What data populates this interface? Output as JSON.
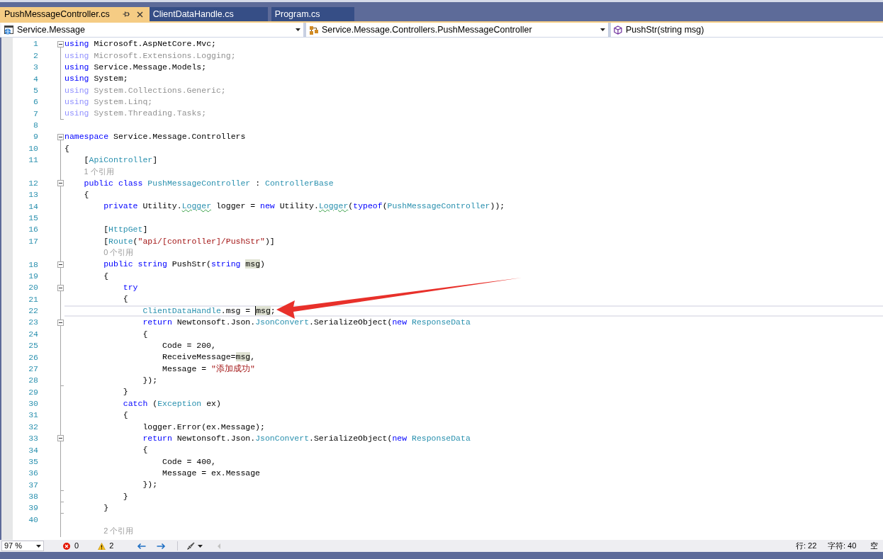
{
  "tabs": [
    {
      "label": "PushMessageController.cs",
      "selected": true
    },
    {
      "label": "ClientDataHandle.cs",
      "selected": false
    },
    {
      "label": "Program.cs",
      "selected": false
    }
  ],
  "navigation": [
    {
      "kind": "project",
      "text": "Service.Message"
    },
    {
      "kind": "class",
      "text": "Service.Message.Controllers.PushMessageController"
    },
    {
      "kind": "method",
      "text": "PushStr(string msg)"
    }
  ],
  "editor": {
    "lines": [
      {
        "kind": "code",
        "number": "1",
        "collapsible": true,
        "unused": false,
        "current": false,
        "tokens": [
          {
            "text": "using",
            "kind": "keyword"
          },
          {
            "text": " Microsoft.AspNetCore.Mvc;",
            "kind": "plain"
          }
        ]
      },
      {
        "kind": "code",
        "number": "2",
        "unused": true,
        "current": false,
        "tokens": [
          {
            "text": "using",
            "kind": "keyword"
          },
          {
            "text": " Microsoft.Extensions.Logging;",
            "kind": "plain"
          }
        ]
      },
      {
        "kind": "code",
        "number": "3",
        "unused": false,
        "current": false,
        "tokens": [
          {
            "text": "using",
            "kind": "keyword"
          },
          {
            "text": " Service.Message.Models;",
            "kind": "plain"
          }
        ]
      },
      {
        "kind": "code",
        "number": "4",
        "unused": false,
        "current": false,
        "tokens": [
          {
            "text": "using",
            "kind": "keyword"
          },
          {
            "text": " System;",
            "kind": "plain"
          }
        ]
      },
      {
        "kind": "code",
        "number": "5",
        "unused": true,
        "current": false,
        "tokens": [
          {
            "text": "using",
            "kind": "keyword"
          },
          {
            "text": " System.Collections.Generic;",
            "kind": "plain"
          }
        ]
      },
      {
        "kind": "code",
        "number": "6",
        "unused": true,
        "current": false,
        "tokens": [
          {
            "text": "using",
            "kind": "keyword"
          },
          {
            "text": " System.Linq;",
            "kind": "plain"
          }
        ]
      },
      {
        "kind": "code",
        "number": "7",
        "region_end": true,
        "unused": true,
        "current": false,
        "tokens": [
          {
            "text": "using",
            "kind": "keyword"
          },
          {
            "text": " System.Threading.Tasks;",
            "kind": "plain"
          }
        ]
      },
      {
        "kind": "code",
        "number": "8",
        "current": false
      },
      {
        "kind": "code",
        "number": "9",
        "collapsible": true,
        "unused": false,
        "current": false,
        "tokens": [
          {
            "text": "namespace",
            "kind": "keyword"
          },
          {
            "text": " Service.Message.Controllers",
            "kind": "plain"
          }
        ]
      },
      {
        "kind": "code",
        "number": "10",
        "unused": false,
        "current": false,
        "tokens": [
          {
            "text": "{",
            "kind": "plain"
          }
        ],
        "children": [
          {
            "kind": "code",
            "number": "11",
            "unused": false,
            "current": false,
            "tokens": [
              {
                "text": "[",
                "kind": "plain"
              },
              {
                "text": "ApiController",
                "kind": "type"
              },
              {
                "text": "]",
                "kind": "plain"
              }
            ]
          },
          {
            "kind": "codelens",
            "text": "1 个引用"
          },
          {
            "kind": "code",
            "number": "12",
            "collapsible": true,
            "unused": false,
            "current": false,
            "tokens": [
              {
                "text": "public ",
                "kind": "keyword"
              },
              {
                "text": "class ",
                "kind": "keyword"
              },
              {
                "text": "PushMessageController",
                "kind": "type"
              },
              {
                "text": " : ",
                "kind": "plain"
              },
              {
                "text": "ControllerBase",
                "kind": "type"
              }
            ]
          },
          {
            "kind": "code",
            "number": "13",
            "unused": false,
            "current": false,
            "tokens": [
              {
                "text": "{",
                "kind": "plain"
              }
            ],
            "children": [
              {
                "kind": "code",
                "number": "14",
                "unused": false,
                "current": false,
                "tokens": [
                  {
                    "text": "private",
                    "kind": "keyword"
                  },
                  {
                    "text": " Utility.",
                    "kind": "plain"
                  },
                  {
                    "text": "Logger",
                    "kind": "type",
                    "squiggle": true
                  },
                  {
                    "text": " logger = ",
                    "kind": "plain"
                  },
                  {
                    "text": "new",
                    "kind": "keyword"
                  },
                  {
                    "text": " Utility.",
                    "kind": "plain"
                  },
                  {
                    "text": "Logger",
                    "kind": "type",
                    "squiggle": true
                  },
                  {
                    "text": "(",
                    "kind": "plain"
                  },
                  {
                    "text": "typeof",
                    "kind": "keyword"
                  },
                  {
                    "text": "(",
                    "kind": "plain"
                  },
                  {
                    "text": "PushMessageController",
                    "kind": "type"
                  },
                  {
                    "text": "));",
                    "kind": "plain"
                  }
                ]
              },
              {
                "kind": "code",
                "number": "15",
                "current": false
              },
              {
                "kind": "code",
                "number": "16",
                "unused": false,
                "current": false,
                "tokens": [
                  {
                    "text": "[",
                    "kind": "plain"
                  },
                  {
                    "text": "HttpGet",
                    "kind": "type"
                  },
                  {
                    "text": "]",
                    "kind": "plain"
                  }
                ]
              },
              {
                "kind": "code",
                "number": "17",
                "unused": false,
                "current": false,
                "tokens": [
                  {
                    "text": "[",
                    "kind": "plain"
                  },
                  {
                    "text": "Route",
                    "kind": "type"
                  },
                  {
                    "text": "(",
                    "kind": "plain"
                  },
                  {
                    "text": "\"api/[controller]/PushStr\"",
                    "kind": "string"
                  },
                  {
                    "text": ")]",
                    "kind": "plain"
                  }
                ]
              },
              {
                "kind": "codelens",
                "text": "0 个引用"
              },
              {
                "kind": "code",
                "number": "18",
                "collapsible": true,
                "unused": false,
                "current": false,
                "tokens": [
                  {
                    "text": "public ",
                    "kind": "keyword"
                  },
                  {
                    "text": "string ",
                    "kind": "keyword"
                  },
                  {
                    "text": "PushStr(",
                    "kind": "plain"
                  },
                  {
                    "text": "string ",
                    "kind": "keyword"
                  },
                  {
                    "text": "msg",
                    "kind": "plain",
                    "highlight": true
                  },
                  {
                    "text": ")",
                    "kind": "plain"
                  }
                ]
              },
              {
                "kind": "code",
                "number": "19",
                "unused": false,
                "current": false,
                "tokens": [
                  {
                    "text": "{",
                    "kind": "plain"
                  }
                ],
                "children": [
                  {
                    "kind": "code",
                    "number": "20",
                    "collapsible": true,
                    "unused": false,
                    "current": false,
                    "tokens": [
                      {
                        "text": "try",
                        "kind": "keyword"
                      }
                    ]
                  },
                  {
                    "kind": "code",
                    "number": "21",
                    "unused": false,
                    "current": false,
                    "tokens": [
                      {
                        "text": "{",
                        "kind": "plain"
                      }
                    ],
                    "children": [
                      {
                        "kind": "code",
                        "number": "22",
                        "unused": false,
                        "current": true,
                        "tokens": [
                          {
                            "text": "ClientDataHandle",
                            "kind": "type"
                          },
                          {
                            "text": ".msg = ",
                            "kind": "plain"
                          },
                          {
                            "text": "msg",
                            "kind": "plain",
                            "highlight": true,
                            "caret": true
                          },
                          {
                            "text": ";",
                            "kind": "plain"
                          }
                        ]
                      },
                      {
                        "kind": "code",
                        "number": "23",
                        "collapsible": true,
                        "unused": false,
                        "current": false,
                        "tokens": [
                          {
                            "text": "return",
                            "kind": "keyword"
                          },
                          {
                            "text": " Newtonsoft.Json.",
                            "kind": "plain"
                          },
                          {
                            "text": "JsonConvert",
                            "kind": "type"
                          },
                          {
                            "text": ".SerializeObject(",
                            "kind": "plain"
                          },
                          {
                            "text": "new ",
                            "kind": "keyword"
                          },
                          {
                            "text": "ResponseData",
                            "kind": "type"
                          }
                        ]
                      },
                      {
                        "kind": "code",
                        "number": "24",
                        "unused": false,
                        "current": false,
                        "tokens": [
                          {
                            "text": "{",
                            "kind": "plain"
                          }
                        ],
                        "children": [
                          {
                            "kind": "code",
                            "number": "25",
                            "unused": false,
                            "current": false,
                            "tokens": [
                              {
                                "text": "Code = 200,",
                                "kind": "plain"
                              }
                            ]
                          },
                          {
                            "kind": "code",
                            "number": "26",
                            "unused": false,
                            "current": false,
                            "tokens": [
                              {
                                "text": "ReceiveMessage=",
                                "kind": "plain"
                              },
                              {
                                "text": "msg",
                                "kind": "plain",
                                "highlight": true
                              },
                              {
                                "text": ",",
                                "kind": "plain"
                              }
                            ]
                          },
                          {
                            "kind": "code",
                            "number": "27",
                            "unused": false,
                            "current": false,
                            "tokens": [
                              {
                                "text": "Message = ",
                                "kind": "plain"
                              },
                              {
                                "text": "\"添加成功\"",
                                "kind": "string"
                              }
                            ]
                          }
                        ]
                      },
                      {
                        "kind": "code",
                        "number": "28",
                        "region_end": true,
                        "unused": false,
                        "current": false,
                        "tokens": [
                          {
                            "text": "});",
                            "kind": "plain"
                          }
                        ]
                      }
                    ]
                  },
                  {
                    "kind": "code",
                    "number": "29",
                    "unused": false,
                    "current": false,
                    "tokens": [
                      {
                        "text": "}",
                        "kind": "plain"
                      }
                    ]
                  },
                  {
                    "kind": "code",
                    "number": "30",
                    "unused": false,
                    "current": false,
                    "tokens": [
                      {
                        "text": "catch",
                        "kind": "keyword"
                      },
                      {
                        "text": " (",
                        "kind": "plain"
                      },
                      {
                        "text": "Exception",
                        "kind": "type"
                      },
                      {
                        "text": " ex)",
                        "kind": "plain"
                      }
                    ]
                  },
                  {
                    "kind": "code",
                    "number": "31",
                    "unused": false,
                    "current": false,
                    "tokens": [
                      {
                        "text": "{",
                        "kind": "plain"
                      }
                    ],
                    "children": [
                      {
                        "kind": "code",
                        "number": "32",
                        "unused": false,
                        "current": false,
                        "tokens": [
                          {
                            "text": "logger.Error(ex.Message);",
                            "kind": "plain"
                          }
                        ]
                      },
                      {
                        "kind": "code",
                        "number": "33",
                        "collapsible": true,
                        "unused": false,
                        "current": false,
                        "tokens": [
                          {
                            "text": "return",
                            "kind": "keyword"
                          },
                          {
                            "text": " Newtonsoft.Json.",
                            "kind": "plain"
                          },
                          {
                            "text": "JsonConvert",
                            "kind": "type"
                          },
                          {
                            "text": ".SerializeObject(",
                            "kind": "plain"
                          },
                          {
                            "text": "new ",
                            "kind": "keyword"
                          },
                          {
                            "text": "ResponseData",
                            "kind": "type"
                          }
                        ]
                      },
                      {
                        "kind": "code",
                        "number": "34",
                        "unused": false,
                        "current": false,
                        "tokens": [
                          {
                            "text": "{",
                            "kind": "plain"
                          }
                        ],
                        "children": [
                          {
                            "kind": "code",
                            "number": "35",
                            "unused": false,
                            "current": false,
                            "tokens": [
                              {
                                "text": "Code = 400,",
                                "kind": "plain"
                              }
                            ]
                          },
                          {
                            "kind": "code",
                            "number": "36",
                            "unused": false,
                            "current": false,
                            "tokens": [
                              {
                                "text": "Message = ex.Message",
                                "kind": "plain"
                              }
                            ]
                          }
                        ]
                      },
                      {
                        "kind": "code",
                        "number": "37",
                        "region_end": true,
                        "unused": false,
                        "current": false,
                        "tokens": [
                          {
                            "text": "});",
                            "kind": "plain"
                          }
                        ]
                      }
                    ]
                  },
                  {
                    "kind": "code",
                    "number": "38",
                    "region_end": true,
                    "unused": false,
                    "current": false,
                    "tokens": [
                      {
                        "text": "}",
                        "kind": "plain"
                      }
                    ]
                  }
                ]
              },
              {
                "kind": "code",
                "number": "39",
                "region_end": true,
                "unused": false,
                "current": false,
                "tokens": [
                  {
                    "text": "}",
                    "kind": "plain"
                  }
                ]
              },
              {
                "kind": "code",
                "number": "40",
                "current": false
              },
              {
                "kind": "codelens",
                "text": "2 个引用"
              }
            ]
          }
        ]
      }
    ]
  },
  "status_bar": {
    "zoom": "97 %",
    "errors": "0",
    "warnings": "2",
    "line": "行: 22",
    "column": "字符: 40",
    "indent": "空"
  }
}
